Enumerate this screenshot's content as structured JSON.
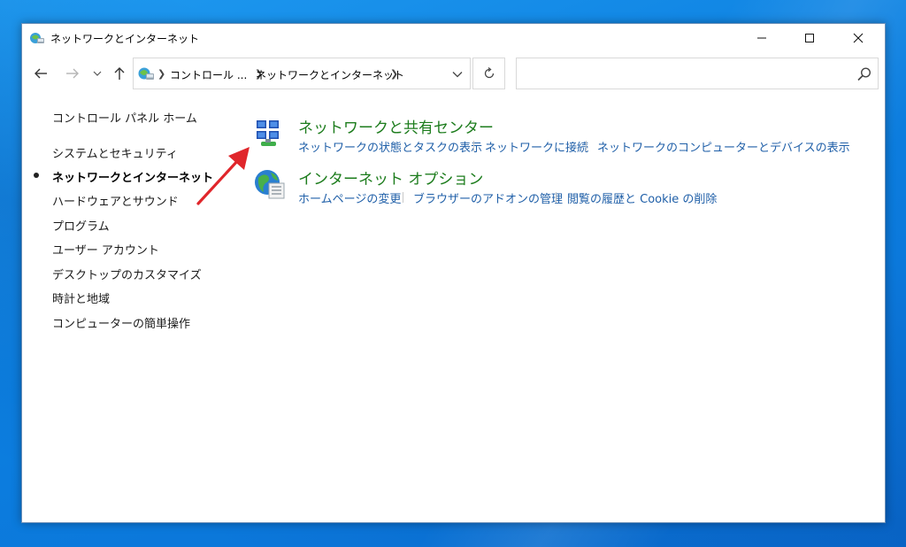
{
  "window": {
    "title": "ネットワークとインターネット"
  },
  "address": {
    "crumbs": [
      "コントロール ...",
      "ネットワークとインターネット"
    ],
    "search_placeholder": ""
  },
  "sidebar": {
    "home": "コントロール パネル ホーム",
    "items": [
      {
        "label": "システムとセキュリティ",
        "active": false
      },
      {
        "label": "ネットワークとインターネット",
        "active": true
      },
      {
        "label": "ハードウェアとサウンド",
        "active": false
      },
      {
        "label": "プログラム",
        "active": false
      },
      {
        "label": "ユーザー アカウント",
        "active": false
      },
      {
        "label": "デスクトップのカスタマイズ",
        "active": false
      },
      {
        "label": "時計と地域",
        "active": false
      },
      {
        "label": "コンピューターの簡単操作",
        "active": false
      }
    ]
  },
  "categories": [
    {
      "title": "ネットワークと共有センター",
      "icon": "network-sharing-center-icon",
      "links": [
        "ネットワークの状態とタスクの表示",
        "ネットワークに接続",
        "ネットワークのコンピューターとデバイスの表示"
      ]
    },
    {
      "title": "インターネット オプション",
      "icon": "internet-options-icon",
      "links": [
        "ホームページの変更",
        "ブラウザーのアドオンの管理",
        "閲覧の履歴と Cookie の削除"
      ]
    }
  ],
  "colors": {
    "category_title": "#1c7c1c",
    "link": "#1f5fa8",
    "annotation_arrow": "#e0262b",
    "desktop": "#0c7fe0"
  }
}
